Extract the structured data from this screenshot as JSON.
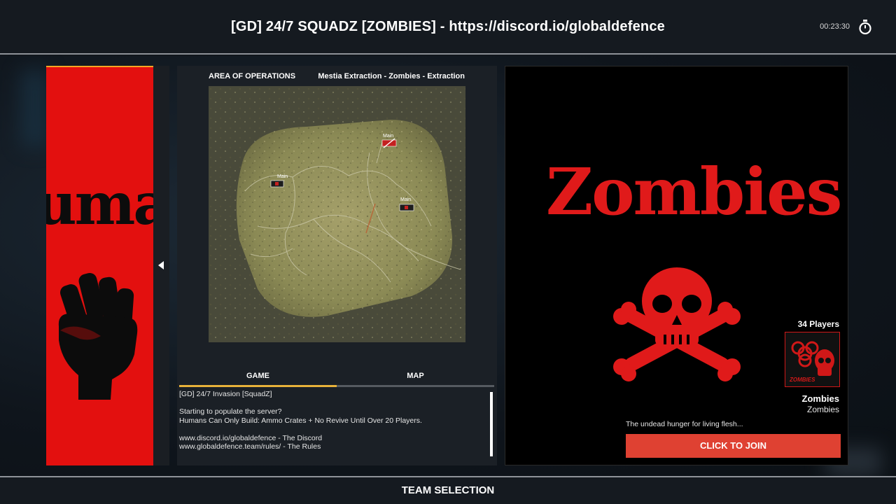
{
  "header": {
    "server_title": "[GD] 24/7 SQUADZ [ZOMBIES] - https://discord.io/globaldefence",
    "timer": "00:23:30"
  },
  "left_team": {
    "banner_text": "uma",
    "color": "#e3100f"
  },
  "map_panel": {
    "area_label": "AREA OF OPERATIONS",
    "layer_name": "Mestia Extraction - Zombies - Extraction",
    "markers": [
      "Main",
      "Main",
      "Main"
    ]
  },
  "tabs": [
    {
      "label": "GAME",
      "active": true
    },
    {
      "label": "MAP",
      "active": false
    }
  ],
  "game_info": {
    "lines": [
      "[GD] 24/7 Invasion [SquadZ]",
      "",
      "Starting to populate the server?",
      "Humans Can Only Build: Ammo Crates + No Revive Until Over 20 Players.",
      "",
      "www.discord.io/globaldefence - The Discord",
      "www.globaldefence.team/rules/ - The Rules"
    ]
  },
  "right_team": {
    "title": "Zombies",
    "players": "34 Players",
    "logo_text": "ZOMBIES",
    "faction_name": "Zombies",
    "faction_sub": "Zombies",
    "description": "The undead hunger for living flesh...",
    "join_label": "CLICK TO JOIN",
    "accent_color": "#df4132"
  },
  "footer": {
    "label": "TEAM SELECTION"
  }
}
